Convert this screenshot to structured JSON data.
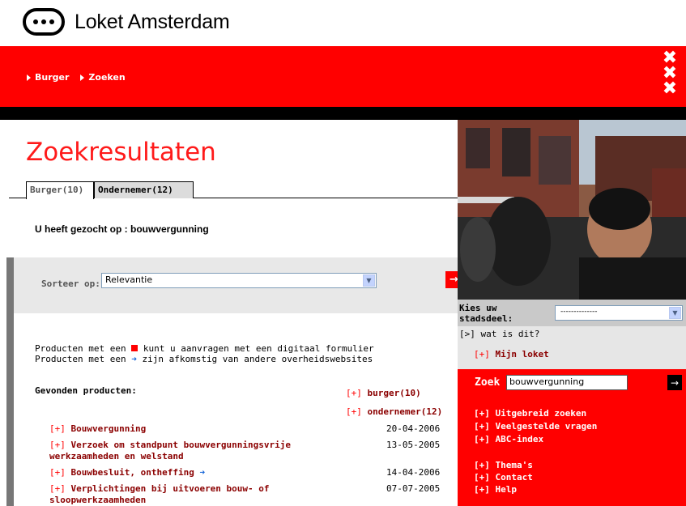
{
  "header": {
    "logo_text": "Loket Amsterdam"
  },
  "nav": {
    "breadcrumbs": [
      "Burger",
      "Zoeken"
    ],
    "xxx": [
      "✖",
      "✖",
      "✖"
    ]
  },
  "main": {
    "title": "Zoekresultaten",
    "tabs": [
      {
        "label": "Burger(10)",
        "active": true
      },
      {
        "label": "Ondernemer(12)",
        "active": false
      }
    ],
    "query_text": "U heeft gezocht op : bouwvergunning",
    "sort": {
      "label": "Sorteer op:",
      "value": "Relevantie"
    },
    "legend": {
      "line1_prefix": "Producten met een",
      "line1_suffix": "kunt u aanvragen met een digitaal formulier",
      "line2_prefix": "Producten met een",
      "line2_suffix": "zijn afkomstig van andere overheidswebsites"
    },
    "found_label": "Gevonden producten:",
    "categories": {
      "burger": "burger(10)",
      "ondernemer": "ondernemer(12)",
      "plus": "[+]"
    },
    "results": [
      {
        "plus": "[+]",
        "title": "Bouwvergunning",
        "date": "20-04-2006"
      },
      {
        "plus": "[+]",
        "title": "Verzoek om standpunt bouwvergunningsvrije werkzaamheden en welstand",
        "date": "13-05-2005"
      },
      {
        "plus": "[+]",
        "title": "Bouwbesluit, ontheffing",
        "date": "14-04-2006",
        "external": true
      },
      {
        "plus": "[+]",
        "title": "Verplichtingen bij uitvoeren bouw- of sloopwerkzaamheden",
        "date": "07-07-2005"
      }
    ]
  },
  "sidebar": {
    "kies_label": "Kies uw stadsdeel:",
    "stadsdeel_value": "--------------",
    "wat_is_dit": "[>] wat is dit?",
    "mijn_loket_plus": "[+]",
    "mijn_loket": "Mijn loket",
    "zoek_label": "Zoek",
    "zoek_value": "bouwvergunning",
    "links": [
      "[+] Uitgebreid zoeken",
      "[+] Veelgestelde vragen",
      "[+] ABC-index",
      "[+] Thema's",
      "[+] Contact",
      "[+] Help"
    ]
  },
  "colors": {
    "brand_red": "#ff0000",
    "link_dark_red": "#8b0000",
    "external_arrow": "#1565d8"
  }
}
